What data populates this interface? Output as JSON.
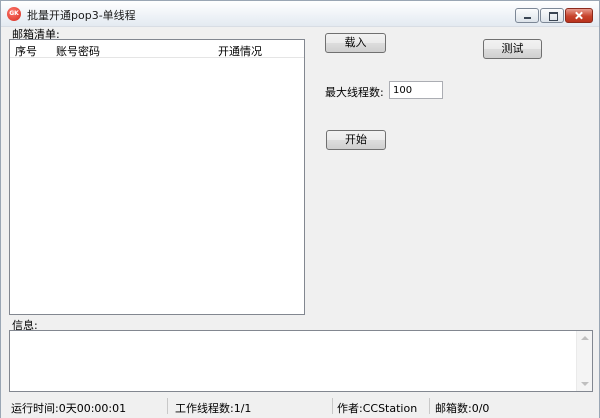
{
  "window": {
    "title": "批量开通pop3-单线程",
    "icon": "app-logo-icon"
  },
  "mailbox_list": {
    "label": "邮箱清单:",
    "columns": [
      "序号",
      "账号密码",
      "开通情况"
    ],
    "rows": []
  },
  "controls": {
    "load_label": "载入",
    "test_label": "测试",
    "max_threads_label": "最大线程数:",
    "max_threads_value": "100",
    "start_label": "开始"
  },
  "info": {
    "label": "信息:",
    "content": ""
  },
  "statusbar": {
    "runtime": "运行时间:0天00:00:01",
    "threads": "工作线程数:1/1",
    "author": "作者:CCStation",
    "mailboxes": "邮箱数:0/0"
  }
}
